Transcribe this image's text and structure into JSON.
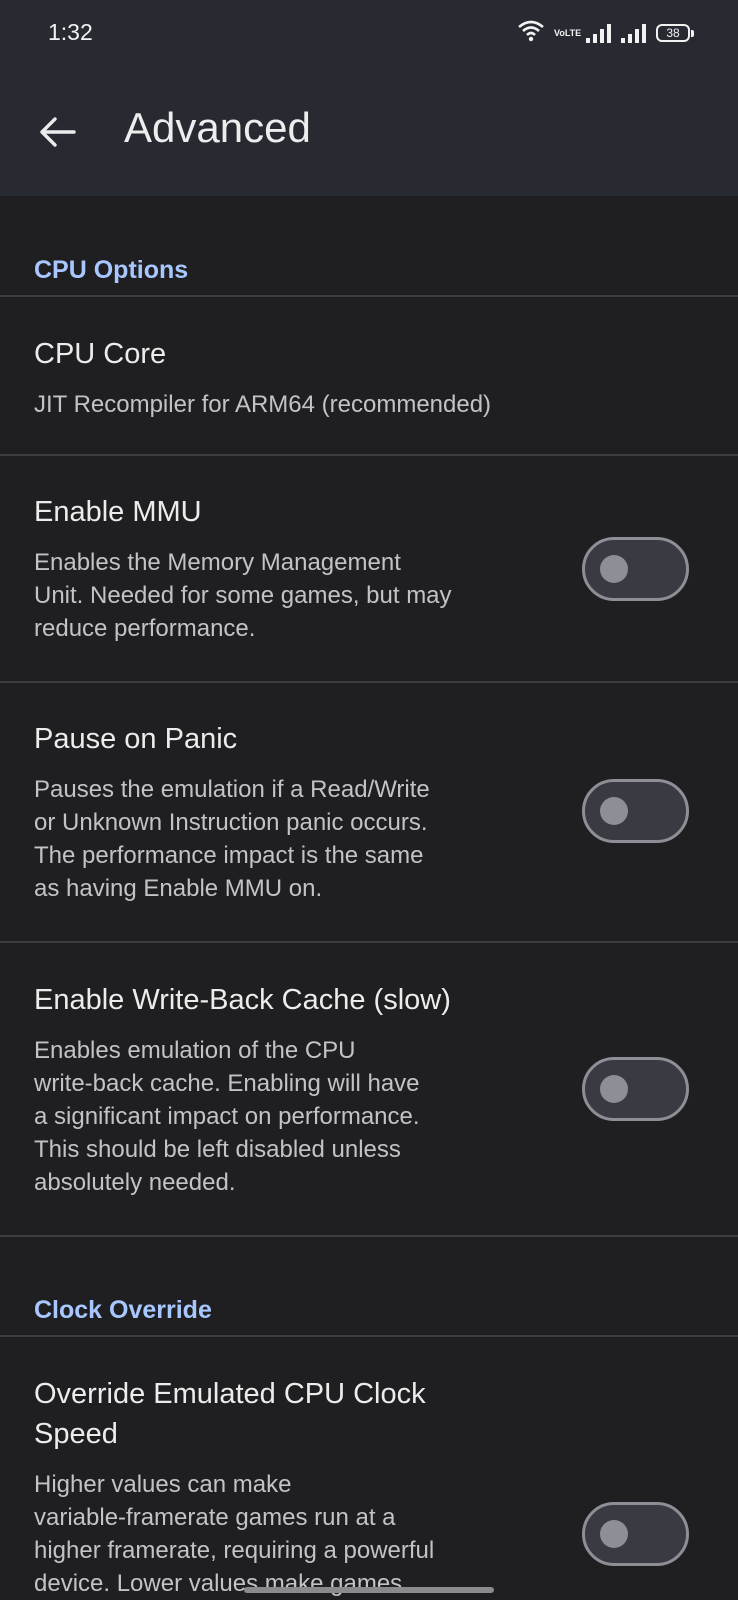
{
  "status_bar": {
    "time": "1:32",
    "network_badge": "VoLTE",
    "battery": "38"
  },
  "app_bar": {
    "title": "Advanced"
  },
  "sections": [
    {
      "header": "CPU Options"
    },
    {
      "header": "Clock Override"
    }
  ],
  "settings": {
    "cpu_core": {
      "title": "CPU Core",
      "summary": "JIT Recompiler for ARM64 (recommended)"
    },
    "enable_mmu": {
      "title": "Enable MMU",
      "summary_lines": [
        "Enables the Memory Management",
        "Unit. Needed for some games, but may",
        "reduce performance."
      ],
      "enabled": false
    },
    "pause_on_panic": {
      "title": "Pause on Panic",
      "summary_lines": [
        "Pauses the emulation if a Read/Write",
        "or Unknown Instruction panic occurs.",
        "The performance impact is the same",
        "as having Enable MMU on."
      ],
      "enabled": false
    },
    "write_back_cache": {
      "title": "Enable Write-Back Cache (slow)",
      "summary_lines": [
        "Enables emulation of the CPU",
        "write-back cache. Enabling will have",
        "a significant impact on performance.",
        "This should be left disabled unless",
        "absolutely needed."
      ],
      "enabled": false
    },
    "override_clock": {
      "title_lines": [
        "Override Emulated CPU Clock",
        "Speed"
      ],
      "summary_lines": [
        "Higher values can make",
        "variable-framerate games run at a",
        "higher framerate, requiring a powerful",
        "device. Lower values make games"
      ],
      "enabled": false
    }
  },
  "colors": {
    "background": "#1f1f21",
    "app_bar": "#272a30",
    "accent": "#a9c7ff",
    "switch_off": "#8e8f96"
  }
}
